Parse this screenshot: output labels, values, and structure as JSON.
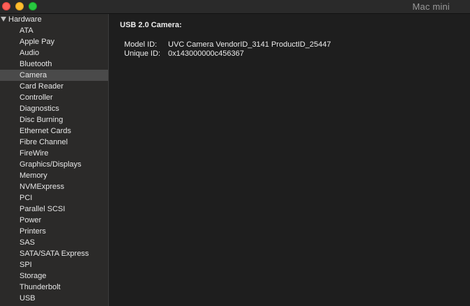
{
  "window": {
    "title": "Mac mini"
  },
  "sidebar": {
    "section": "Hardware",
    "items": [
      {
        "label": "ATA"
      },
      {
        "label": "Apple Pay"
      },
      {
        "label": "Audio"
      },
      {
        "label": "Bluetooth"
      },
      {
        "label": "Camera",
        "selected": true
      },
      {
        "label": "Card Reader"
      },
      {
        "label": "Controller"
      },
      {
        "label": "Diagnostics"
      },
      {
        "label": "Disc Burning"
      },
      {
        "label": "Ethernet Cards"
      },
      {
        "label": "Fibre Channel"
      },
      {
        "label": "FireWire"
      },
      {
        "label": "Graphics/Displays"
      },
      {
        "label": "Memory"
      },
      {
        "label": "NVMExpress"
      },
      {
        "label": "PCI"
      },
      {
        "label": "Parallel SCSI"
      },
      {
        "label": "Power"
      },
      {
        "label": "Printers"
      },
      {
        "label": "SAS"
      },
      {
        "label": "SATA/SATA Express"
      },
      {
        "label": "SPI"
      },
      {
        "label": "Storage"
      },
      {
        "label": "Thunderbolt"
      },
      {
        "label": "USB"
      }
    ]
  },
  "detail": {
    "device_title": "USB 2.0 Camera:",
    "model_id_label": "Model ID:",
    "model_id_value": "UVC Camera VendorID_3141 ProductID_25447",
    "unique_id_label": "Unique ID:",
    "unique_id_value": "0x143000000c456367"
  },
  "colors": {
    "close": "#ff5f57",
    "minimize": "#febc2e",
    "zoom": "#28c840",
    "selection": "#4a4a4a"
  }
}
